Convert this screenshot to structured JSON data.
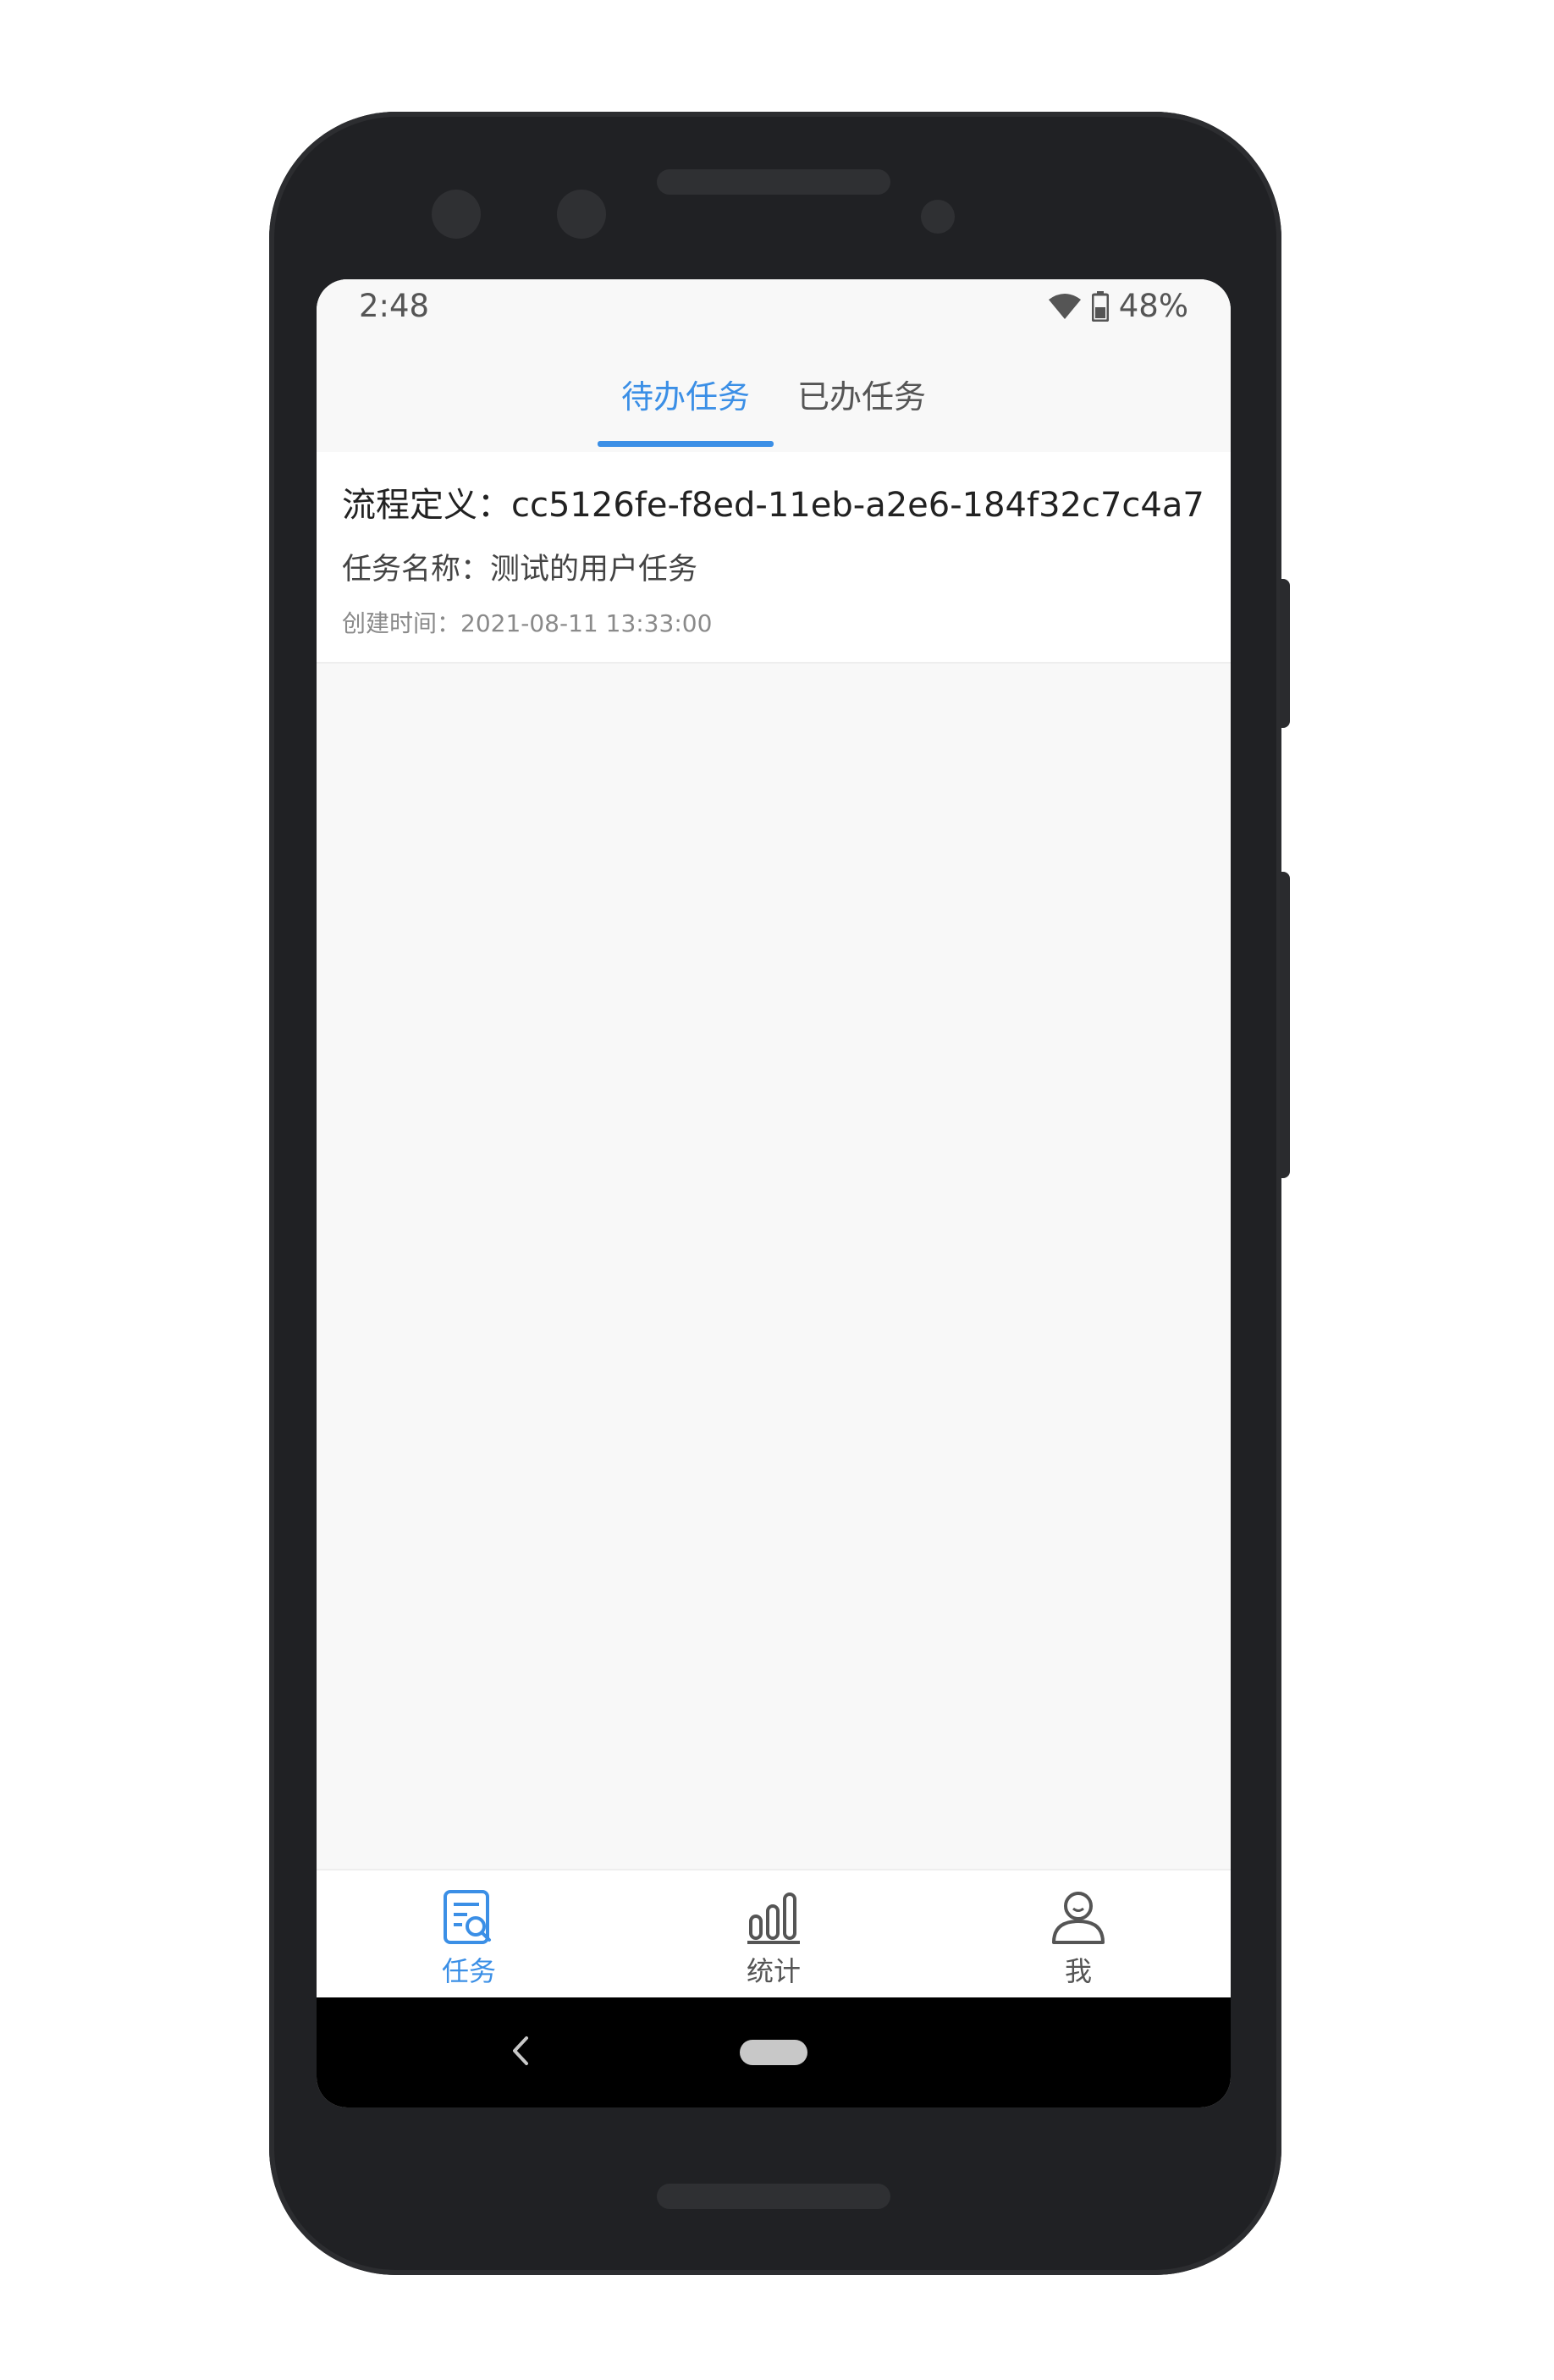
{
  "status_bar": {
    "time": "2:48",
    "battery": "48%",
    "icons": [
      "wifi-icon",
      "battery-icon"
    ]
  },
  "tabs": [
    {
      "label": "待办任务",
      "active": true
    },
    {
      "label": "已办任务",
      "active": false
    }
  ],
  "tasks": [
    {
      "process_definition": "流程定义：cc5126fe-f8ed-11eb-a2e6-184f32c7c4a7",
      "task_name": "任务名称：测试的用户任务",
      "created_time": "创建时间：2021-08-11 13:33:00"
    }
  ],
  "bottom_nav": [
    {
      "label": "任务",
      "icon": "task-search-icon",
      "active": true
    },
    {
      "label": "统计",
      "icon": "bar-chart-icon",
      "active": false
    },
    {
      "label": "我",
      "icon": "user-icon",
      "active": false
    }
  ],
  "colors": {
    "accent": "#3b8fe6",
    "text_primary": "#222222",
    "text_secondary": "#555555",
    "text_muted": "#8a8a8a",
    "background": "#f8f8f8"
  }
}
